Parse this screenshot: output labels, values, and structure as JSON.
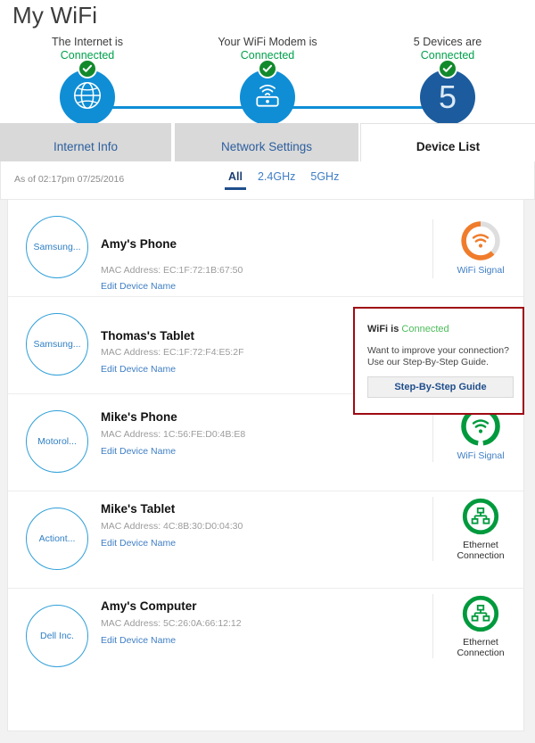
{
  "header": {
    "title": "My WiFi"
  },
  "status": {
    "nodes": [
      {
        "name": "internet",
        "line1": "The Internet is",
        "state": "Connected",
        "icon": "globe-icon",
        "count": ""
      },
      {
        "name": "modem",
        "line1": "Your WiFi Modem is",
        "state": "Connected",
        "icon": "modem-icon",
        "count": ""
      },
      {
        "name": "devices",
        "line1": "Devices are",
        "state": "Connected",
        "icon": "device-count",
        "count": "5"
      }
    ]
  },
  "tabs": [
    {
      "label": "Internet Info",
      "active": false
    },
    {
      "label": "Network Settings",
      "active": false
    },
    {
      "label": "Device List",
      "active": true
    }
  ],
  "filterbar": {
    "as_of": "As of 02:17pm 07/25/2016",
    "freq_tabs": [
      {
        "label": "All",
        "active": true
      },
      {
        "label": "2.4GHz",
        "active": false
      },
      {
        "label": "5GHz",
        "active": false
      }
    ]
  },
  "devices": [
    {
      "vendor": "Samsung...",
      "name": "Amy's Phone",
      "mac_label": "MAC Address: EC:1F:72:1B:67:50",
      "edit_label": "Edit Device Name",
      "connection": {
        "type": "wifi",
        "label": "WiFi Signal",
        "strength": "partial",
        "color": "#f07c2b"
      }
    },
    {
      "vendor": "Samsung...",
      "name": "Thomas's Tablet",
      "mac_label": "MAC Address: EC:1F:72:F4:E5:2F",
      "edit_label": "Edit Device Name",
      "connection": {
        "type": "wifi",
        "label": "",
        "strength": "hidden",
        "color": "#f07c2b"
      }
    },
    {
      "vendor": "Motorol...",
      "name": "Mike's Phone",
      "mac_label": "MAC Address: 1C:56:FE:D0:4B:E8",
      "edit_label": "Edit Device Name",
      "connection": {
        "type": "wifi",
        "label": "WiFi Signal",
        "strength": "full",
        "color": "#009a3d"
      }
    },
    {
      "vendor": "Actiont...",
      "name": "Mike's Tablet",
      "mac_label": "MAC Address: 4C:8B:30:D0:04:30",
      "edit_label": "Edit Device Name",
      "connection": {
        "type": "ethernet",
        "label": "Ethernet\nConnection",
        "label_line1": "Ethernet",
        "label_line2": "Connection",
        "color": "#009a3d"
      }
    },
    {
      "vendor": "Dell Inc.",
      "name": "Amy's Computer",
      "mac_label": "MAC Address: 5C:26:0A:66:12:12",
      "edit_label": "Edit Device Name",
      "connection": {
        "type": "ethernet",
        "label": "Ethernet\nConnection",
        "label_line1": "Ethernet",
        "label_line2": "Connection",
        "color": "#009a3d"
      }
    }
  ],
  "callout": {
    "title_prefix": "WiFi is",
    "title_state": "Connected",
    "body": "Want to improve your connection? Use our Step-By-Step Guide.",
    "button_label": "Step-By-Step Guide",
    "border_color": "#9e0a13"
  },
  "colors": {
    "primary_blue": "#0f8ed6",
    "dark_blue": "#1c5c9e",
    "green": "#00a14b",
    "orange": "#f07c2b",
    "link_blue": "#3e7ec4",
    "tab_gray": "#d9d9d9"
  }
}
